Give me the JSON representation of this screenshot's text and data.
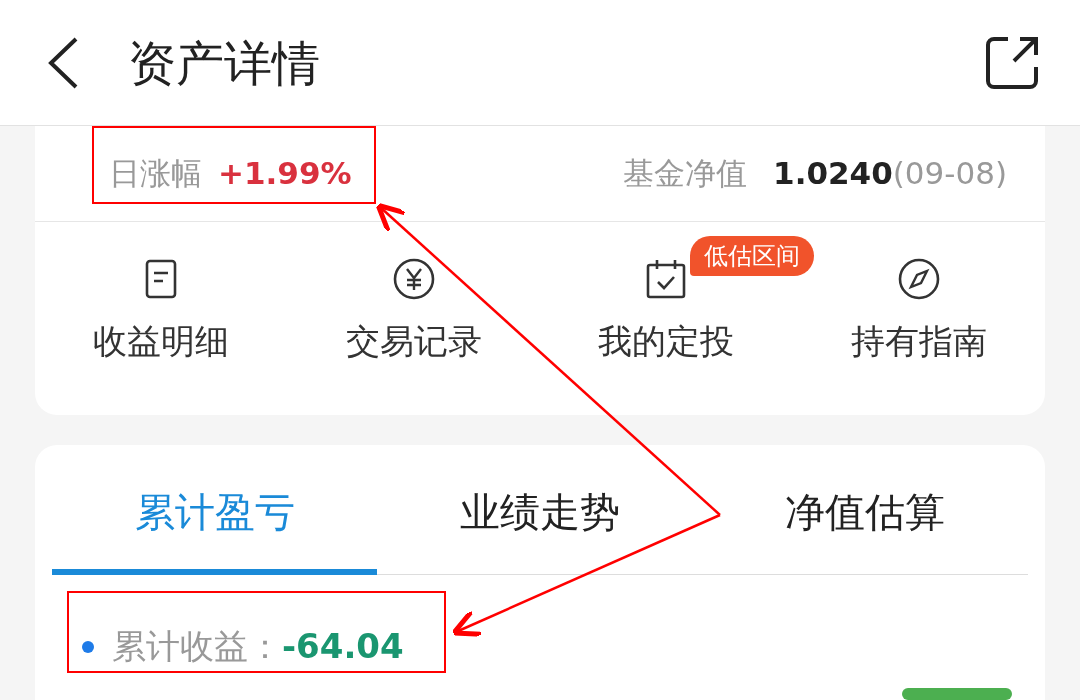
{
  "header": {
    "title": "资产详情"
  },
  "summary": {
    "daily_change_label": "日涨幅",
    "daily_change_value": "+1.99%",
    "nav_label": "基金净值",
    "nav_value": "1.0240",
    "nav_date": "(09-08)"
  },
  "actions": [
    {
      "kind": "doc",
      "label": "收益明细"
    },
    {
      "kind": "yen",
      "label": "交易记录"
    },
    {
      "kind": "calendar",
      "label": "我的定投",
      "badge": "低估区间"
    },
    {
      "kind": "compass",
      "label": "持有指南"
    }
  ],
  "tabs": [
    {
      "label": "累计盈亏",
      "selected": true
    },
    {
      "label": "业绩走势",
      "selected": false
    },
    {
      "label": "净值估算",
      "selected": false
    }
  ],
  "cumulative": {
    "label": "累计收益：",
    "value": "-64.04"
  }
}
